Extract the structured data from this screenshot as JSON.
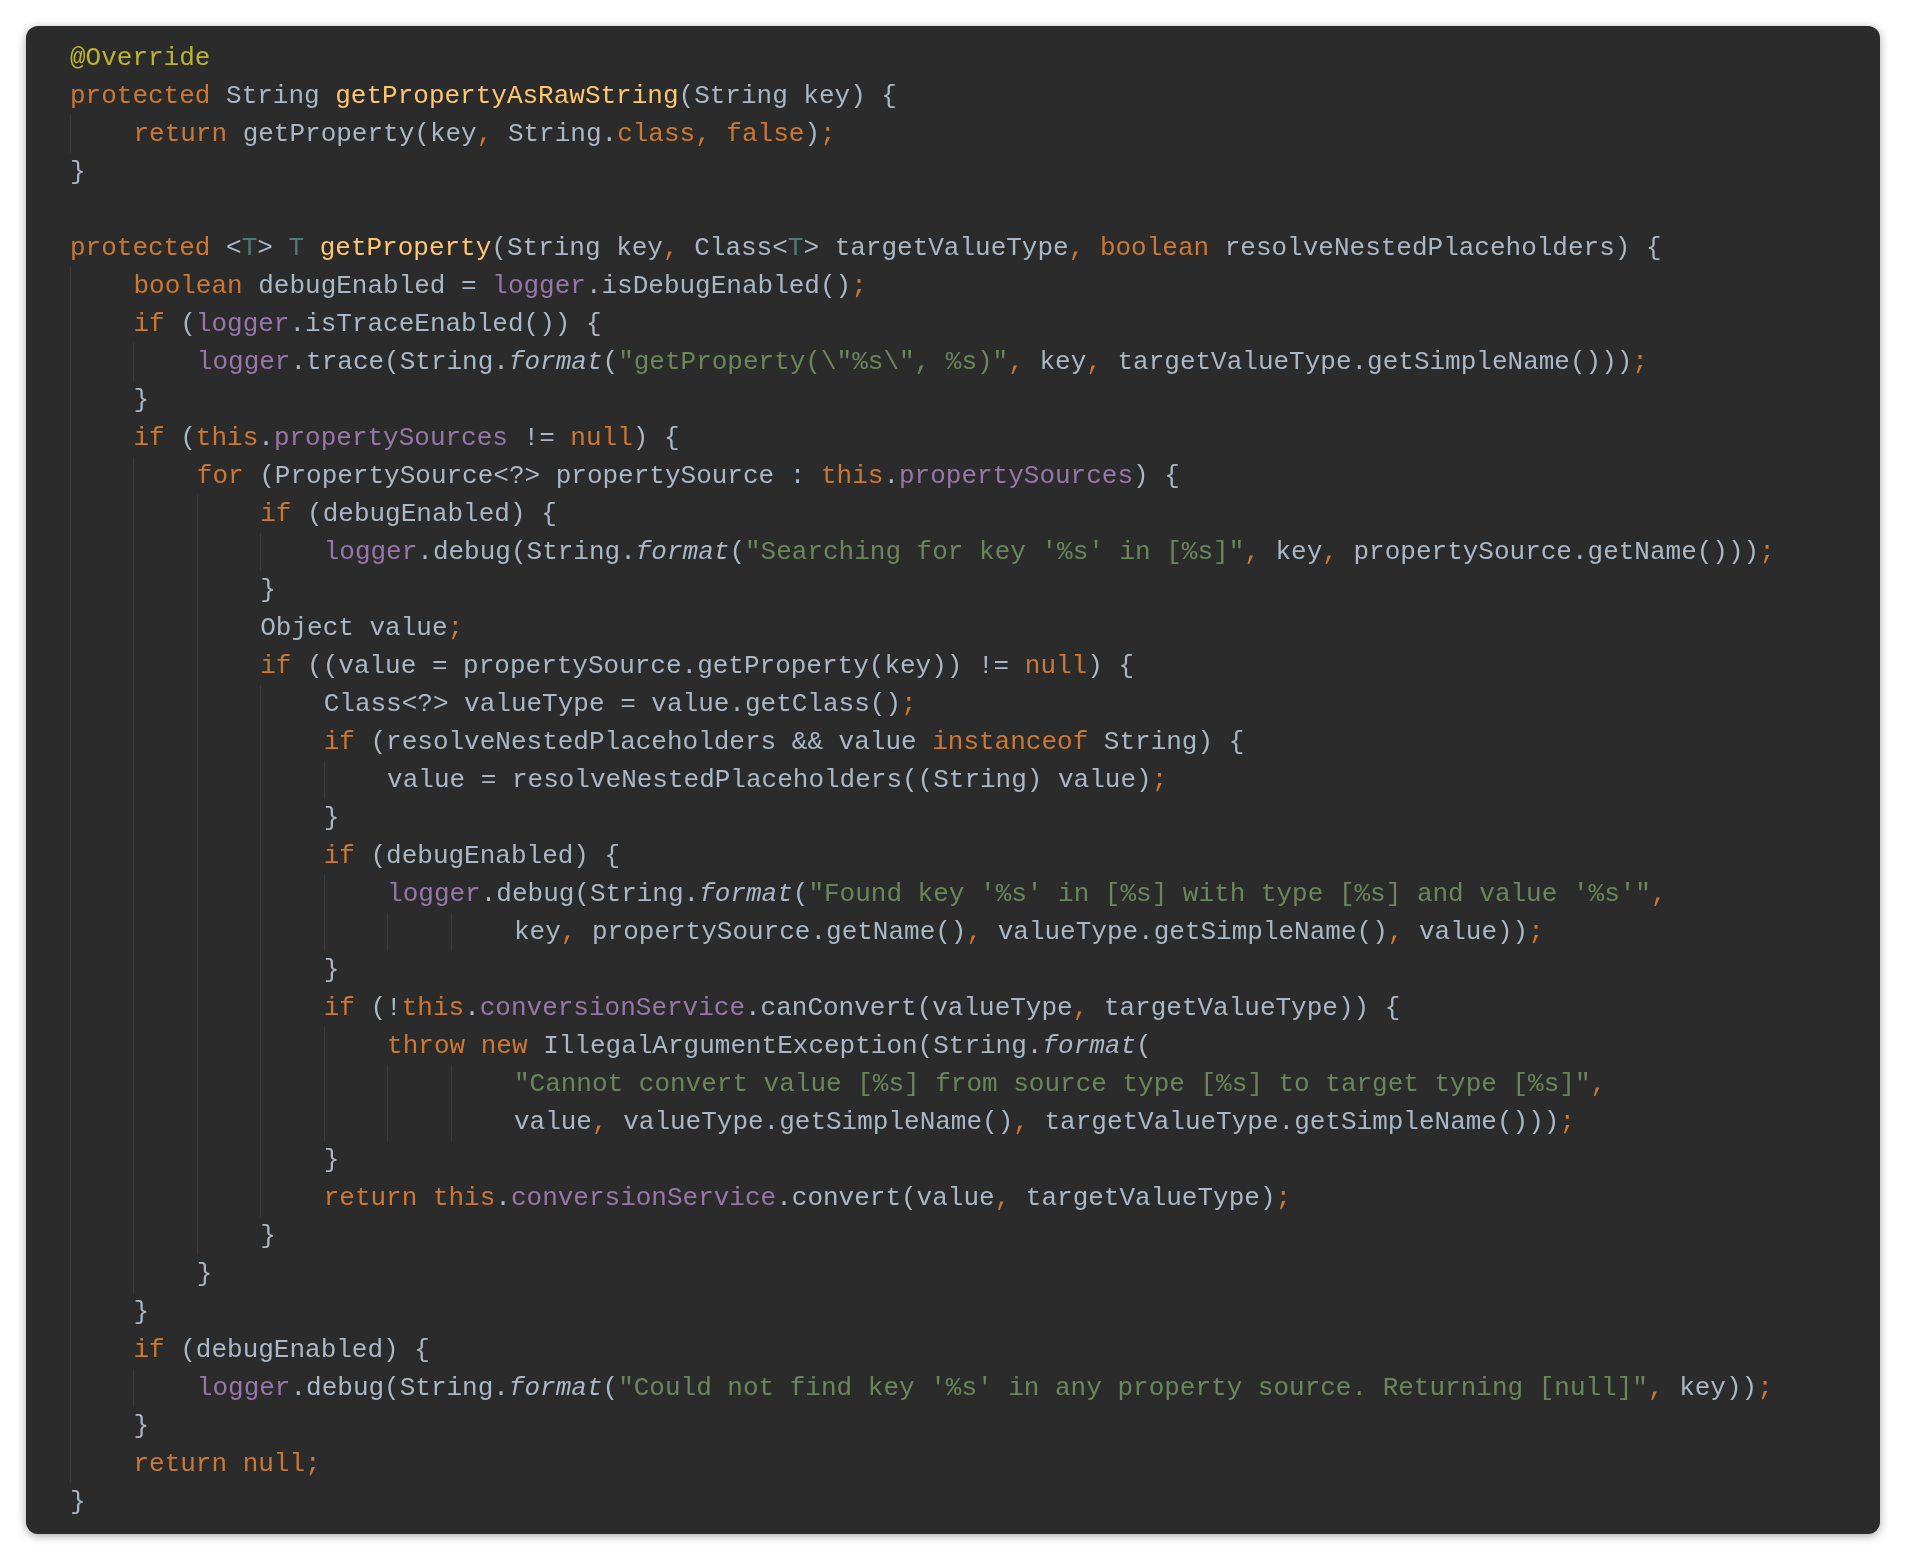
{
  "code_lines": [
    {
      "kind": "code",
      "tokens": [
        {
          "kind": "annotation",
          "text": "@Override"
        }
      ]
    },
    {
      "kind": "code",
      "tokens": [
        {
          "kind": "keyword",
          "text": "protected"
        },
        {
          "kind": "plain",
          "text": " String "
        },
        {
          "kind": "method",
          "text": "getPropertyAsRawString"
        },
        {
          "kind": "plain",
          "text": "(String key) {"
        }
      ]
    },
    {
      "kind": "code",
      "tokens": [
        {
          "kind": "keyword",
          "text": "    return"
        },
        {
          "kind": "plain",
          "text": " getProperty(key"
        },
        {
          "kind": "punct",
          "text": ", "
        },
        {
          "kind": "plain",
          "text": "String."
        },
        {
          "kind": "keyword",
          "text": "class"
        },
        {
          "kind": "punct",
          "text": ", "
        },
        {
          "kind": "keyword",
          "text": "false"
        },
        {
          "kind": "plain",
          "text": ")"
        },
        {
          "kind": "punct",
          "text": ";"
        }
      ]
    },
    {
      "kind": "code",
      "tokens": [
        {
          "kind": "plain",
          "text": "}"
        }
      ]
    },
    {
      "kind": "blank"
    },
    {
      "kind": "code",
      "tokens": [
        {
          "kind": "keyword",
          "text": "protected"
        },
        {
          "kind": "plain",
          "text": " <"
        },
        {
          "kind": "type_param",
          "text": "T"
        },
        {
          "kind": "plain",
          "text": "> "
        },
        {
          "kind": "type_param",
          "text": "T"
        },
        {
          "kind": "method",
          "text": " getProperty"
        },
        {
          "kind": "plain",
          "text": "(String key"
        },
        {
          "kind": "punct",
          "text": ", "
        },
        {
          "kind": "plain",
          "text": "Class<"
        },
        {
          "kind": "type_param",
          "text": "T"
        },
        {
          "kind": "plain",
          "text": "> targetValueType"
        },
        {
          "kind": "punct",
          "text": ", "
        },
        {
          "kind": "keyword",
          "text": "boolean"
        },
        {
          "kind": "plain",
          "text": " resolveNestedPlaceholders) {"
        }
      ]
    },
    {
      "kind": "code",
      "tokens": [
        {
          "kind": "keyword",
          "text": "    boolean"
        },
        {
          "kind": "plain",
          "text": " debugEnabled = "
        },
        {
          "kind": "field",
          "text": "logger"
        },
        {
          "kind": "plain",
          "text": ".isDebugEnabled()"
        },
        {
          "kind": "punct",
          "text": ";"
        }
      ]
    },
    {
      "kind": "code",
      "tokens": [
        {
          "kind": "keyword",
          "text": "    if"
        },
        {
          "kind": "plain",
          "text": " ("
        },
        {
          "kind": "field",
          "text": "logger"
        },
        {
          "kind": "plain",
          "text": ".isTraceEnabled()) {"
        }
      ]
    },
    {
      "kind": "code",
      "tokens": [
        {
          "kind": "field",
          "text": "        logger"
        },
        {
          "kind": "plain",
          "text": ".trace(String."
        },
        {
          "kind": "static",
          "text": "format"
        },
        {
          "kind": "plain",
          "text": "("
        },
        {
          "kind": "string",
          "text": "\"getProperty(\\\"%s\\\", %s)\""
        },
        {
          "kind": "punct",
          "text": ", "
        },
        {
          "kind": "plain",
          "text": "key"
        },
        {
          "kind": "punct",
          "text": ", "
        },
        {
          "kind": "plain",
          "text": "targetValueType.getSimpleName()))"
        },
        {
          "kind": "punct",
          "text": ";"
        }
      ]
    },
    {
      "kind": "code",
      "tokens": [
        {
          "kind": "plain",
          "text": "    }"
        }
      ]
    },
    {
      "kind": "code",
      "tokens": [
        {
          "kind": "keyword",
          "text": "    if"
        },
        {
          "kind": "plain",
          "text": " ("
        },
        {
          "kind": "keyword",
          "text": "this"
        },
        {
          "kind": "plain",
          "text": "."
        },
        {
          "kind": "field",
          "text": "propertySources"
        },
        {
          "kind": "plain",
          "text": " != "
        },
        {
          "kind": "keyword",
          "text": "null"
        },
        {
          "kind": "plain",
          "text": ") {"
        }
      ]
    },
    {
      "kind": "code",
      "tokens": [
        {
          "kind": "keyword",
          "text": "        for"
        },
        {
          "kind": "plain",
          "text": " (PropertySource<?> propertySource : "
        },
        {
          "kind": "keyword",
          "text": "this"
        },
        {
          "kind": "plain",
          "text": "."
        },
        {
          "kind": "field",
          "text": "propertySources"
        },
        {
          "kind": "plain",
          "text": ") {"
        }
      ]
    },
    {
      "kind": "code",
      "tokens": [
        {
          "kind": "keyword",
          "text": "            if"
        },
        {
          "kind": "plain",
          "text": " (debugEnabled) {"
        }
      ]
    },
    {
      "kind": "code",
      "tokens": [
        {
          "kind": "field",
          "text": "                logger"
        },
        {
          "kind": "plain",
          "text": ".debug(String."
        },
        {
          "kind": "static",
          "text": "format"
        },
        {
          "kind": "plain",
          "text": "("
        },
        {
          "kind": "string",
          "text": "\"Searching for key '%s' in [%s]\""
        },
        {
          "kind": "punct",
          "text": ", "
        },
        {
          "kind": "plain",
          "text": "key"
        },
        {
          "kind": "punct",
          "text": ", "
        },
        {
          "kind": "plain",
          "text": "propertySource.getName()))"
        },
        {
          "kind": "punct",
          "text": ";"
        }
      ]
    },
    {
      "kind": "code",
      "tokens": [
        {
          "kind": "plain",
          "text": "            }"
        }
      ]
    },
    {
      "kind": "code",
      "tokens": [
        {
          "kind": "plain",
          "text": "            Object value"
        },
        {
          "kind": "punct",
          "text": ";"
        }
      ]
    },
    {
      "kind": "code",
      "tokens": [
        {
          "kind": "keyword",
          "text": "            if"
        },
        {
          "kind": "plain",
          "text": " ((value = propertySource.getProperty(key)) != "
        },
        {
          "kind": "keyword",
          "text": "null"
        },
        {
          "kind": "plain",
          "text": ") {"
        }
      ]
    },
    {
      "kind": "code",
      "tokens": [
        {
          "kind": "plain",
          "text": "                Class<?> valueType = value.getClass()"
        },
        {
          "kind": "punct",
          "text": ";"
        }
      ]
    },
    {
      "kind": "code",
      "tokens": [
        {
          "kind": "keyword",
          "text": "                if"
        },
        {
          "kind": "plain",
          "text": " (resolveNestedPlaceholders && value "
        },
        {
          "kind": "keyword",
          "text": "instanceof"
        },
        {
          "kind": "plain",
          "text": " String) {"
        }
      ]
    },
    {
      "kind": "code",
      "tokens": [
        {
          "kind": "plain",
          "text": "                    value = resolveNestedPlaceholders((String) value)"
        },
        {
          "kind": "punct",
          "text": ";"
        }
      ]
    },
    {
      "kind": "code",
      "tokens": [
        {
          "kind": "plain",
          "text": "                }"
        }
      ]
    },
    {
      "kind": "code",
      "tokens": [
        {
          "kind": "keyword",
          "text": "                if"
        },
        {
          "kind": "plain",
          "text": " (debugEnabled) {"
        }
      ]
    },
    {
      "kind": "code",
      "tokens": [
        {
          "kind": "field",
          "text": "                    logger"
        },
        {
          "kind": "plain",
          "text": ".debug(String."
        },
        {
          "kind": "static",
          "text": "format"
        },
        {
          "kind": "plain",
          "text": "("
        },
        {
          "kind": "string",
          "text": "\"Found key '%s' in [%s] with type [%s] and value '%s'\""
        },
        {
          "kind": "punct",
          "text": ","
        }
      ]
    },
    {
      "kind": "code",
      "tokens": [
        {
          "kind": "plain",
          "text": "                            key"
        },
        {
          "kind": "punct",
          "text": ", "
        },
        {
          "kind": "plain",
          "text": "propertySource.getName()"
        },
        {
          "kind": "punct",
          "text": ", "
        },
        {
          "kind": "plain",
          "text": "valueType.getSimpleName()"
        },
        {
          "kind": "punct",
          "text": ", "
        },
        {
          "kind": "plain",
          "text": "value))"
        },
        {
          "kind": "punct",
          "text": ";"
        }
      ]
    },
    {
      "kind": "code",
      "tokens": [
        {
          "kind": "plain",
          "text": "                }"
        }
      ]
    },
    {
      "kind": "code",
      "tokens": [
        {
          "kind": "keyword",
          "text": "                if"
        },
        {
          "kind": "plain",
          "text": " (!"
        },
        {
          "kind": "keyword",
          "text": "this"
        },
        {
          "kind": "plain",
          "text": "."
        },
        {
          "kind": "field",
          "text": "conversionService"
        },
        {
          "kind": "plain",
          "text": ".canConvert(valueType"
        },
        {
          "kind": "punct",
          "text": ", "
        },
        {
          "kind": "plain",
          "text": "targetValueType)) {"
        }
      ]
    },
    {
      "kind": "code",
      "tokens": [
        {
          "kind": "keyword",
          "text": "                    throw new"
        },
        {
          "kind": "plain",
          "text": " IllegalArgumentException(String."
        },
        {
          "kind": "static",
          "text": "format"
        },
        {
          "kind": "plain",
          "text": "("
        }
      ]
    },
    {
      "kind": "code",
      "tokens": [
        {
          "kind": "string",
          "text": "                            \"Cannot convert value [%s] from source type [%s] to target type [%s]\""
        },
        {
          "kind": "punct",
          "text": ","
        }
      ]
    },
    {
      "kind": "code",
      "tokens": [
        {
          "kind": "plain",
          "text": "                            value"
        },
        {
          "kind": "punct",
          "text": ", "
        },
        {
          "kind": "plain",
          "text": "valueType.getSimpleName()"
        },
        {
          "kind": "punct",
          "text": ", "
        },
        {
          "kind": "plain",
          "text": "targetValueType.getSimpleName()))"
        },
        {
          "kind": "punct",
          "text": ";"
        }
      ]
    },
    {
      "kind": "code",
      "tokens": [
        {
          "kind": "plain",
          "text": "                }"
        }
      ]
    },
    {
      "kind": "code",
      "tokens": [
        {
          "kind": "keyword",
          "text": "                return this"
        },
        {
          "kind": "plain",
          "text": "."
        },
        {
          "kind": "field",
          "text": "conversionService"
        },
        {
          "kind": "plain",
          "text": ".convert(value"
        },
        {
          "kind": "punct",
          "text": ", "
        },
        {
          "kind": "plain",
          "text": "targetValueType)"
        },
        {
          "kind": "punct",
          "text": ";"
        }
      ]
    },
    {
      "kind": "code",
      "tokens": [
        {
          "kind": "plain",
          "text": "            }"
        }
      ]
    },
    {
      "kind": "code",
      "tokens": [
        {
          "kind": "plain",
          "text": "        }"
        }
      ]
    },
    {
      "kind": "code",
      "tokens": [
        {
          "kind": "plain",
          "text": "    }"
        }
      ]
    },
    {
      "kind": "code",
      "tokens": [
        {
          "kind": "keyword",
          "text": "    if"
        },
        {
          "kind": "plain",
          "text": " (debugEnabled) {"
        }
      ]
    },
    {
      "kind": "code",
      "tokens": [
        {
          "kind": "field",
          "text": "        logger"
        },
        {
          "kind": "plain",
          "text": ".debug(String."
        },
        {
          "kind": "static",
          "text": "format"
        },
        {
          "kind": "plain",
          "text": "("
        },
        {
          "kind": "string",
          "text": "\"Could not find key '%s' in any property source. Returning [null]\""
        },
        {
          "kind": "punct",
          "text": ", "
        },
        {
          "kind": "plain",
          "text": "key))"
        },
        {
          "kind": "punct",
          "text": ";"
        }
      ]
    },
    {
      "kind": "code",
      "tokens": [
        {
          "kind": "plain",
          "text": "    }"
        }
      ]
    },
    {
      "kind": "code",
      "tokens": [
        {
          "kind": "keyword",
          "text": "    return null"
        },
        {
          "kind": "punct",
          "text": ";"
        }
      ]
    },
    {
      "kind": "code",
      "tokens": [
        {
          "kind": "plain",
          "text": "}"
        }
      ]
    }
  ]
}
